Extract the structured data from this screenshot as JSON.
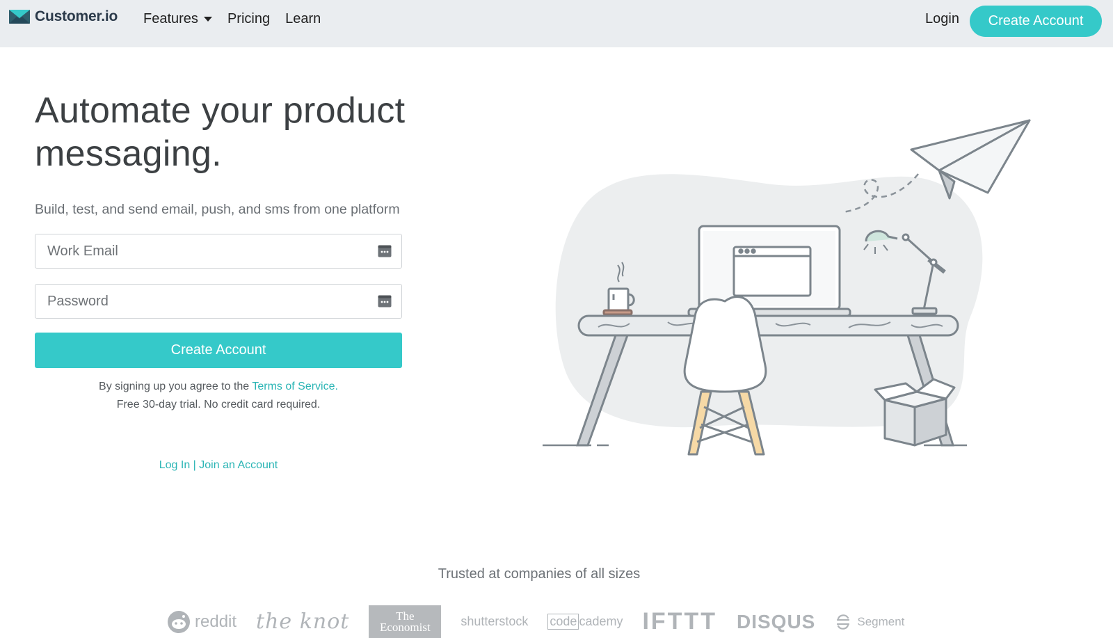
{
  "brand": {
    "name": "Customer.io",
    "accent": "#35c9c9"
  },
  "nav": {
    "features": "Features",
    "pricing": "Pricing",
    "learn": "Learn",
    "login": "Login",
    "cta": "Create Account"
  },
  "hero": {
    "headline": "Automate your product messaging.",
    "subhead": "Build, test, and send email, push, and sms from one platform"
  },
  "form": {
    "email_placeholder": "Work Email",
    "password_placeholder": "Password",
    "submit": "Create Account",
    "legal_prefix": "By signing up you agree to the ",
    "terms_link": "Terms of Service",
    "legal_suffix": ".",
    "trial_note": "Free 30-day trial. No credit card required."
  },
  "auth_links": {
    "login": "Log In",
    "separator": " | ",
    "join": "Join an Account"
  },
  "trust": {
    "heading": "Trusted at companies of all sizes",
    "logos": {
      "reddit": "reddit",
      "knot": "the knot",
      "economist_1": "The",
      "economist_2": "Economist",
      "shutterstock": "shutterstock",
      "code_box": "code",
      "code_rest": "cademy",
      "ifttt": "IFTTT",
      "disqus": "DISQUS",
      "segment": "Segment"
    }
  }
}
